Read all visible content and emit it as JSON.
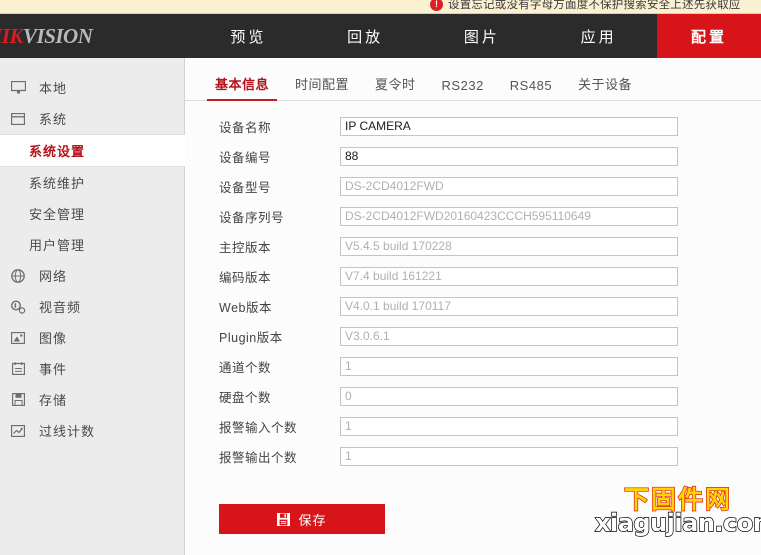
{
  "promo": {
    "badge": "!",
    "text": "设置忘记或没有字母方面度不保护搜索安全上述先获取应"
  },
  "brand": {
    "logo_hik": "HIK",
    "logo_vision": "VISION"
  },
  "nav": {
    "items": [
      {
        "label": "预览",
        "name": "nav-preview",
        "active": false
      },
      {
        "label": "回放",
        "name": "nav-playback",
        "active": false
      },
      {
        "label": "图片",
        "name": "nav-picture",
        "active": false
      },
      {
        "label": "应用",
        "name": "nav-application",
        "active": false
      },
      {
        "label": "配置",
        "name": "nav-configuration",
        "active": true
      }
    ]
  },
  "sidebar": {
    "items": [
      {
        "label": "本地",
        "icon": "monitor-icon",
        "type": "group"
      },
      {
        "label": "系统",
        "icon": "window-icon",
        "type": "group"
      },
      {
        "label": "系统设置",
        "icon": "",
        "type": "sub",
        "active": true
      },
      {
        "label": "系统维护",
        "icon": "",
        "type": "sub",
        "active": false
      },
      {
        "label": "安全管理",
        "icon": "",
        "type": "sub",
        "active": false
      },
      {
        "label": "用户管理",
        "icon": "",
        "type": "sub",
        "active": false
      },
      {
        "label": "网络",
        "icon": "globe-icon",
        "type": "group"
      },
      {
        "label": "视音频",
        "icon": "video-icon",
        "type": "group"
      },
      {
        "label": "图像",
        "icon": "image-icon",
        "type": "group"
      },
      {
        "label": "事件",
        "icon": "event-icon",
        "type": "group"
      },
      {
        "label": "存储",
        "icon": "storage-icon",
        "type": "group"
      },
      {
        "label": "过线计数",
        "icon": "chart-icon",
        "type": "group"
      }
    ]
  },
  "tabs": [
    {
      "label": "基本信息",
      "name": "tab-basic-info",
      "active": true
    },
    {
      "label": "时间配置",
      "name": "tab-time-settings",
      "active": false
    },
    {
      "label": "夏令时",
      "name": "tab-dst",
      "active": false
    },
    {
      "label": "RS232",
      "name": "tab-rs232",
      "active": false
    },
    {
      "label": "RS485",
      "name": "tab-rs485",
      "active": false
    },
    {
      "label": "关于设备",
      "name": "tab-about-device",
      "active": false
    }
  ],
  "form": {
    "fields": [
      {
        "label": "设备名称",
        "value": "IP CAMERA",
        "name": "device-name",
        "readonly": false
      },
      {
        "label": "设备编号",
        "value": "88",
        "name": "device-number",
        "readonly": false
      },
      {
        "label": "设备型号",
        "value": "DS-2CD4012FWD",
        "name": "device-model",
        "readonly": true
      },
      {
        "label": "设备序列号",
        "value": "DS-2CD4012FWD20160423CCCH595110649",
        "name": "device-serial-number",
        "readonly": true
      },
      {
        "label": "主控版本",
        "value": "V5.4.5 build 170228",
        "name": "main-control-version",
        "readonly": true
      },
      {
        "label": "编码版本",
        "value": "V7.4 build 161221",
        "name": "encoding-version",
        "readonly": true
      },
      {
        "label": "Web版本",
        "value": "V4.0.1 build 170117",
        "name": "web-version",
        "readonly": true
      },
      {
        "label": "Plugin版本",
        "value": "V3.0.6.1",
        "name": "plugin-version",
        "readonly": true
      },
      {
        "label": "通道个数",
        "value": "1",
        "name": "channel-count",
        "readonly": true
      },
      {
        "label": "硬盘个数",
        "value": "0",
        "name": "hdd-count",
        "readonly": true
      },
      {
        "label": "报警输入个数",
        "value": "1",
        "name": "alarm-input-count",
        "readonly": true
      },
      {
        "label": "报警输出个数",
        "value": "1",
        "name": "alarm-output-count",
        "readonly": true
      }
    ],
    "save_label": "保存"
  },
  "watermark": {
    "line1": "下固件网",
    "line2": "xiagujian.com"
  },
  "colors": {
    "brand_red": "#d7141a",
    "header_dark": "#2b2b2b",
    "sidebar_bg": "#ececec",
    "active_red": "#b5121b",
    "watermark_yellow": "#ffd400"
  }
}
